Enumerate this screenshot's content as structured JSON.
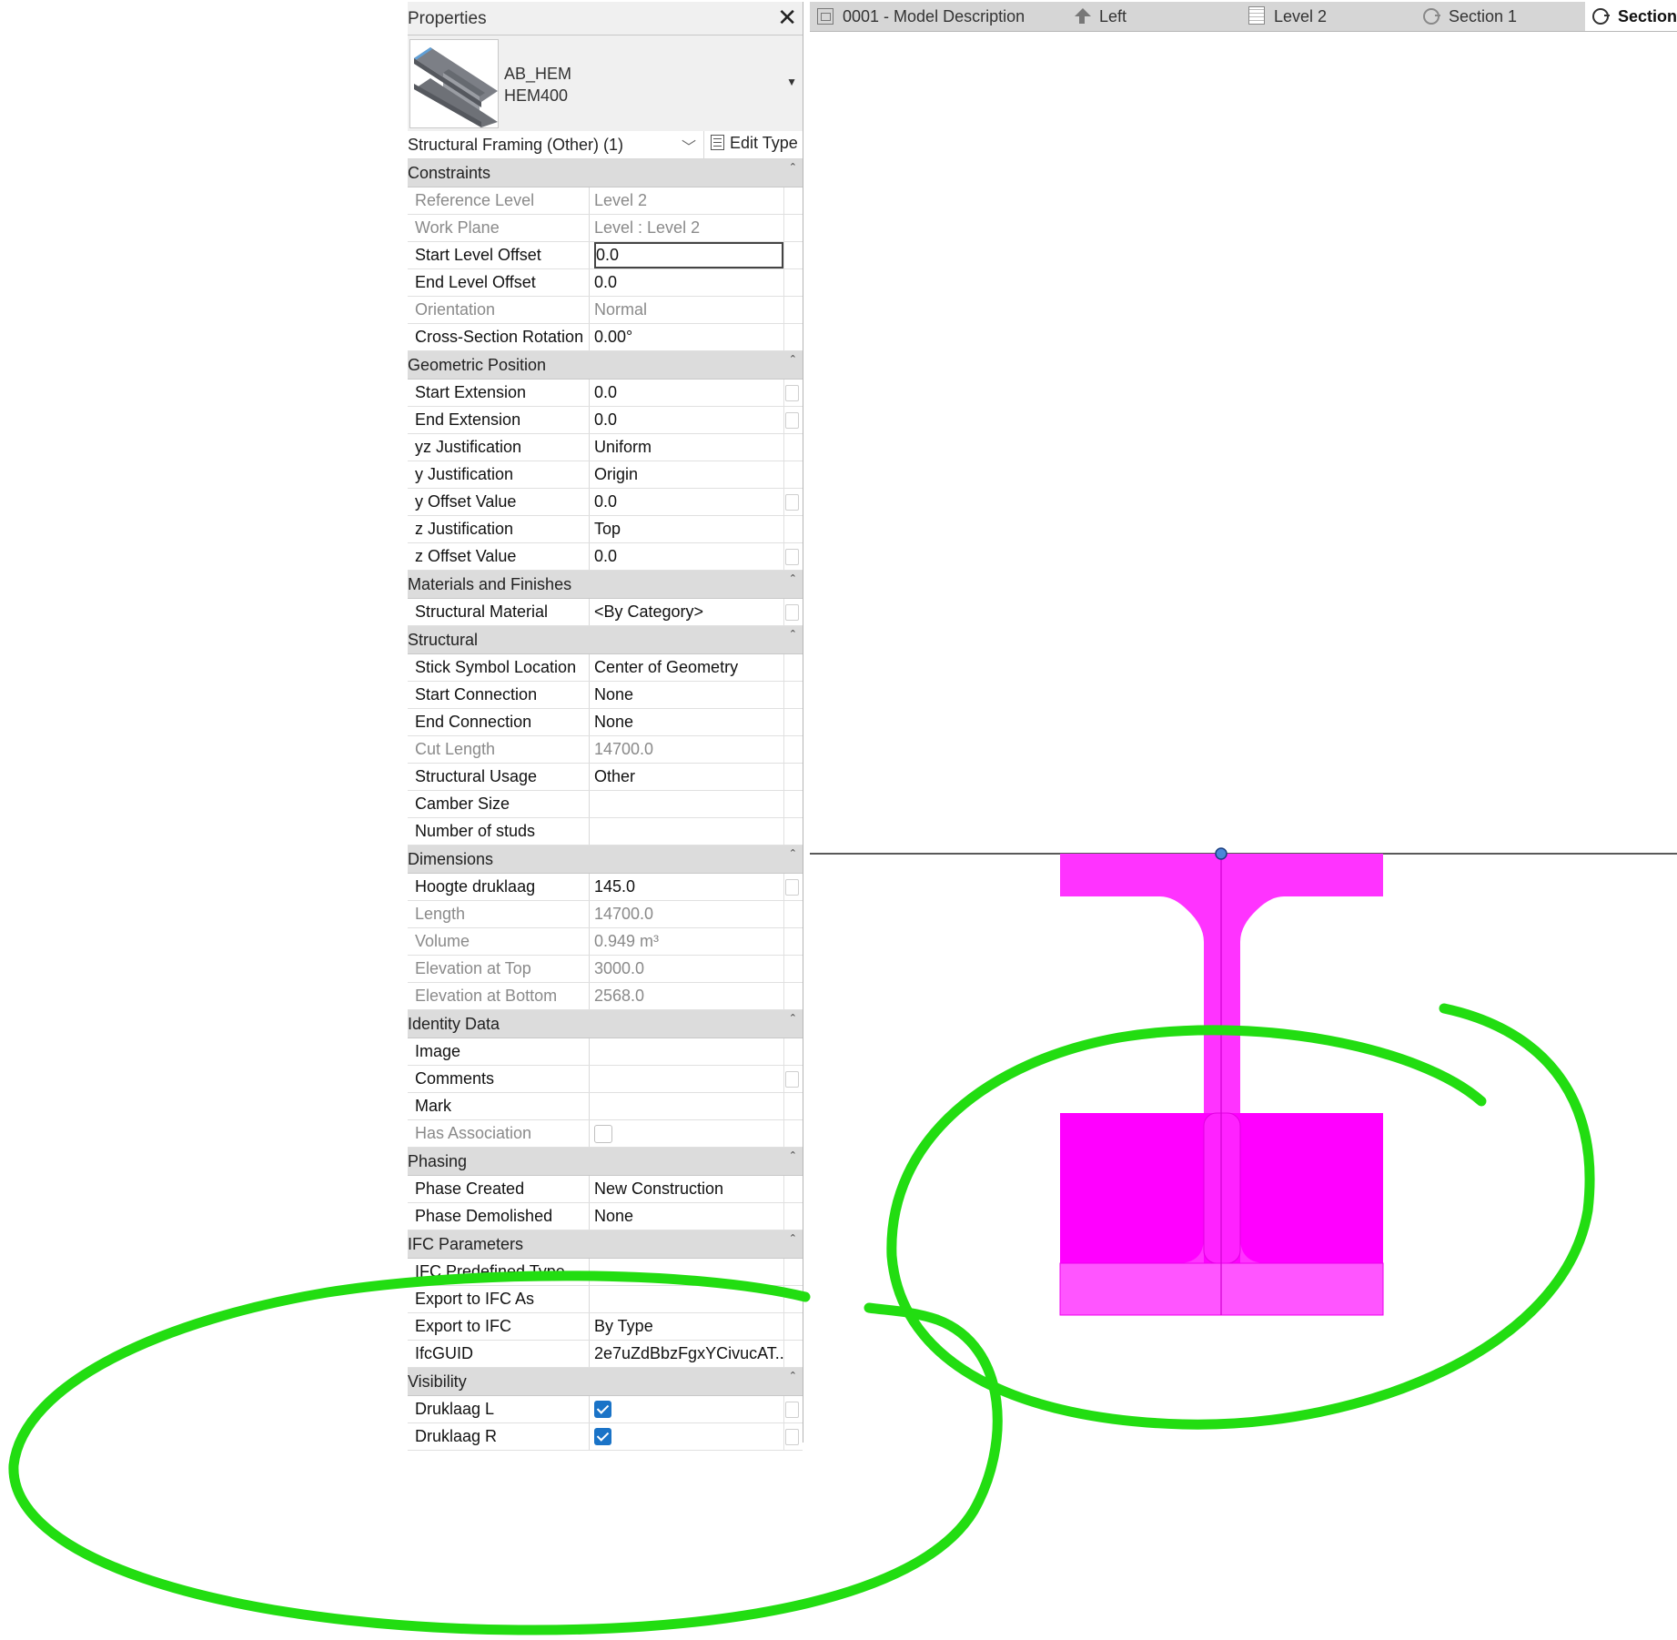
{
  "properties": {
    "title": "Properties",
    "type_selector": {
      "family": "AB_HEM",
      "type": "HEM400"
    },
    "filter": {
      "label": "Structural Framing (Other) (1)",
      "edit_type_label": "Edit Type"
    },
    "groups": [
      {
        "name": "Constraints",
        "rows": [
          {
            "label": "Reference Level",
            "value": "Level 2",
            "readonly": true
          },
          {
            "label": "Work Plane",
            "value": "Level : Level 2",
            "readonly": true
          },
          {
            "label": "Start Level Offset",
            "value": "0.0",
            "readonly": false,
            "active": true
          },
          {
            "label": "End Level Offset",
            "value": "0.0",
            "readonly": false
          },
          {
            "label": "Orientation",
            "value": "Normal",
            "readonly": true
          },
          {
            "label": "Cross-Section Rotation",
            "value": "0.00°",
            "readonly": false
          }
        ]
      },
      {
        "name": "Geometric Position",
        "rows": [
          {
            "label": "Start Extension",
            "value": "0.0",
            "readonly": false,
            "assoc": true
          },
          {
            "label": "End Extension",
            "value": "0.0",
            "readonly": false,
            "assoc": true
          },
          {
            "label": "yz Justification",
            "value": "Uniform",
            "readonly": false
          },
          {
            "label": "y Justification",
            "value": "Origin",
            "readonly": false
          },
          {
            "label": "y Offset Value",
            "value": "0.0",
            "readonly": false,
            "assoc": true
          },
          {
            "label": "z Justification",
            "value": "Top",
            "readonly": false
          },
          {
            "label": "z Offset Value",
            "value": "0.0",
            "readonly": false,
            "assoc": true
          }
        ]
      },
      {
        "name": "Materials and Finishes",
        "rows": [
          {
            "label": "Structural Material",
            "value": "<By Category>",
            "readonly": false,
            "assoc": true
          }
        ]
      },
      {
        "name": "Structural",
        "rows": [
          {
            "label": "Stick Symbol Location",
            "value": "Center of Geometry",
            "readonly": false
          },
          {
            "label": "Start Connection",
            "value": "None",
            "readonly": false
          },
          {
            "label": "End Connection",
            "value": "None",
            "readonly": false
          },
          {
            "label": "Cut Length",
            "value": "14700.0",
            "readonly": true
          },
          {
            "label": "Structural Usage",
            "value": "Other",
            "readonly": false
          },
          {
            "label": "Camber Size",
            "value": "",
            "readonly": false
          },
          {
            "label": "Number of studs",
            "value": "",
            "readonly": false
          }
        ]
      },
      {
        "name": "Dimensions",
        "rows": [
          {
            "label": "Hoogte druklaag",
            "value": "145.0",
            "readonly": false,
            "assoc": true
          },
          {
            "label": "Length",
            "value": "14700.0",
            "readonly": true
          },
          {
            "label": "Volume",
            "value": "0.949 m³",
            "readonly": true
          },
          {
            "label": "Elevation at Top",
            "value": "3000.0",
            "readonly": true
          },
          {
            "label": "Elevation at Bottom",
            "value": "2568.0",
            "readonly": true
          }
        ]
      },
      {
        "name": "Identity Data",
        "rows": [
          {
            "label": "Image",
            "value": "",
            "readonly": false
          },
          {
            "label": "Comments",
            "value": "",
            "readonly": false,
            "assoc": true
          },
          {
            "label": "Mark",
            "value": "",
            "readonly": false
          },
          {
            "label": "Has Association",
            "value": "",
            "readonly": true,
            "checkbox": "off"
          }
        ]
      },
      {
        "name": "Phasing",
        "rows": [
          {
            "label": "Phase Created",
            "value": "New Construction",
            "readonly": false
          },
          {
            "label": "Phase Demolished",
            "value": "None",
            "readonly": false
          }
        ]
      },
      {
        "name": "IFC Parameters",
        "rows": [
          {
            "label": "IFC Predefined Type",
            "value": "",
            "readonly": false
          },
          {
            "label": "Export to IFC As",
            "value": "",
            "readonly": false
          },
          {
            "label": "Export to IFC",
            "value": "By Type",
            "readonly": false
          },
          {
            "label": "IfcGUID",
            "value": "2e7uZdBbzFgxYCivucAT...",
            "readonly": false
          }
        ]
      },
      {
        "name": "Visibility",
        "rows": [
          {
            "label": "Druklaag L",
            "value": "",
            "readonly": false,
            "checkbox": "on",
            "assoc": true
          },
          {
            "label": "Druklaag R",
            "value": "",
            "readonly": false,
            "checkbox": "on",
            "assoc": true
          }
        ]
      }
    ]
  },
  "tabs": [
    {
      "label": "0001 - Model Description",
      "icon": "sheet-icon"
    },
    {
      "label": "Left",
      "icon": "elevation-icon"
    },
    {
      "label": "Level 2",
      "icon": "floor-plan-icon"
    },
    {
      "label": "Section 1",
      "icon": "section-icon"
    },
    {
      "label": "Section",
      "icon": "section-icon",
      "active": true
    }
  ],
  "colors": {
    "beam_fill": "#ff22ff",
    "beam_light": "#ff55ff",
    "beam_edge": "#d400d4",
    "annotation": "#22dd11",
    "checkbox": "#1a73c7"
  }
}
